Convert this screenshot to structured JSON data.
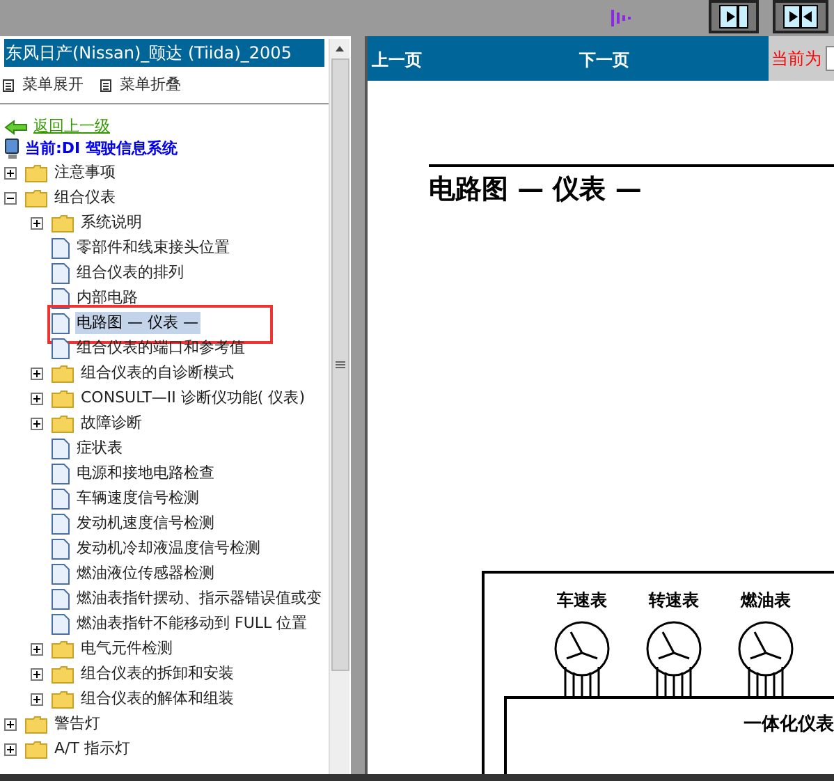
{
  "left_panel": {
    "title": "东风日产(Nissan)_颐达 (Tiida)_2005",
    "menu": [
      "菜单展开",
      "菜单折叠"
    ],
    "back_link": "返回上一级",
    "current": "当前:DI 驾驶信息系统",
    "tree": [
      {
        "label": "注意事项",
        "kind": "folder",
        "expanded": false,
        "selected": false
      },
      {
        "label": "组合仪表",
        "kind": "folder",
        "expanded": true,
        "selected": false,
        "children": [
          {
            "label": "系统说明",
            "kind": "folder",
            "expanded": false,
            "selected": false
          },
          {
            "label": "零部件和线束接头位置",
            "kind": "page",
            "selected": false
          },
          {
            "label": "组合仪表的排列",
            "kind": "page",
            "selected": false
          },
          {
            "label": "内部电路",
            "kind": "page",
            "selected": false
          },
          {
            "label": "电路图 — 仪表 —",
            "kind": "page",
            "selected": true,
            "marked": true
          },
          {
            "label": "组合仪表的端口和参考值",
            "kind": "page",
            "selected": false
          },
          {
            "label": "组合仪表的自诊断模式",
            "kind": "folder",
            "expanded": false,
            "selected": false
          },
          {
            "label": "CONSULT—II 诊断仪功能( 仪表)",
            "kind": "folder",
            "expanded": false,
            "selected": false
          },
          {
            "label": "故障诊断",
            "kind": "folder",
            "expanded": false,
            "selected": false
          },
          {
            "label": "症状表",
            "kind": "page",
            "selected": false
          },
          {
            "label": "电源和接地电路检查",
            "kind": "page",
            "selected": false
          },
          {
            "label": "车辆速度信号检测",
            "kind": "page",
            "selected": false
          },
          {
            "label": "发动机速度信号检测",
            "kind": "page",
            "selected": false
          },
          {
            "label": "发动机冷却液温度信号检测",
            "kind": "page",
            "selected": false
          },
          {
            "label": "燃油液位传感器检测",
            "kind": "page",
            "selected": false
          },
          {
            "label": "燃油表指针摆动、指示器错误值或变",
            "kind": "page",
            "selected": false
          },
          {
            "label": "燃油表指针不能移动到 FULL 位置",
            "kind": "page",
            "selected": false
          },
          {
            "label": "电气元件检测",
            "kind": "folder",
            "expanded": false,
            "selected": false
          },
          {
            "label": "组合仪表的拆卸和安装",
            "kind": "folder",
            "expanded": false,
            "selected": false
          },
          {
            "label": "组合仪表的解体和组装",
            "kind": "folder",
            "expanded": false,
            "selected": false
          }
        ]
      },
      {
        "label": "警告灯",
        "kind": "folder",
        "expanded": false,
        "selected": false
      },
      {
        "label": "A/T 指示灯",
        "kind": "folder",
        "expanded": false,
        "selected": false
      }
    ]
  },
  "document": {
    "nav": [
      "上一页",
      "下一页"
    ],
    "current_label": "当前为",
    "title": "电路图 — 仪表 —",
    "gauges": [
      "车速表",
      "转速表",
      "燃油表"
    ],
    "unit_label": "一体化仪表"
  }
}
